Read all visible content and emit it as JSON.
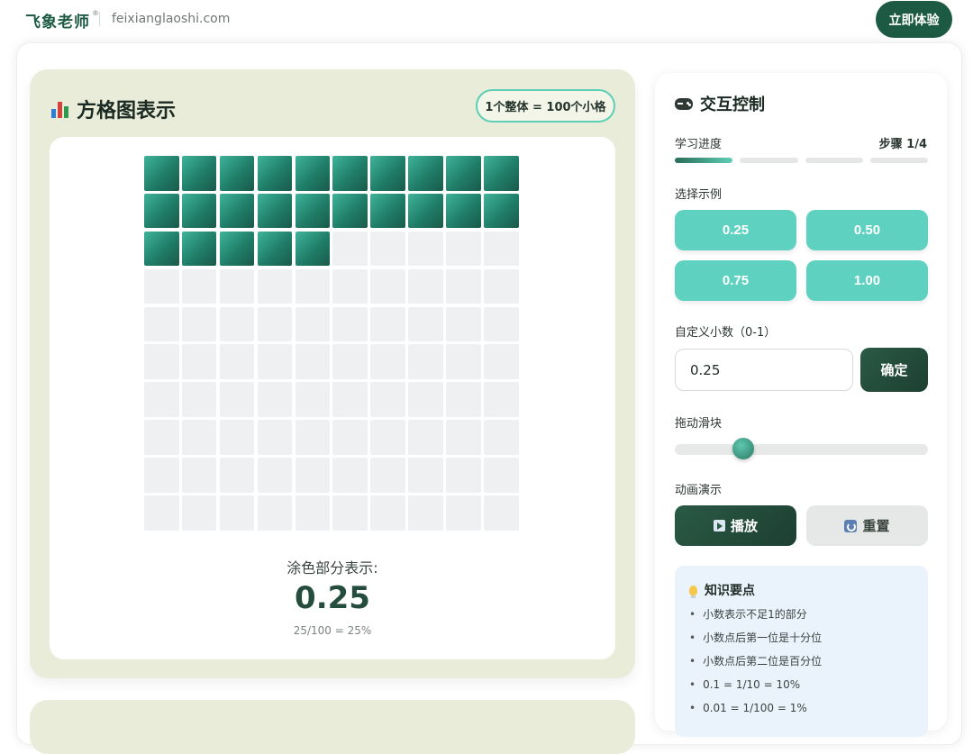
{
  "header": {
    "brand": "飞象老师",
    "brand_mark": "®",
    "domain": "feixianglaoshi.com",
    "cta_label": "立即体验"
  },
  "grid_card": {
    "title": "方格图表示",
    "title_icon": "bar-chart-icon",
    "unit_note": "1个整体 = 100个小格",
    "rows": 10,
    "cols": 10,
    "filled_cells": 25,
    "shade_label": "涂色部分表示:",
    "shade_value": "0.25",
    "shade_detail": "25/100 = 25%",
    "colors": {
      "filled": "#1f7d68",
      "empty": "#eef0f1",
      "card_bg": "#e9ecd9"
    }
  },
  "controls": {
    "title": "交互控制",
    "title_icon": "gamepad-icon",
    "progress_label": "学习进度",
    "step_text": "步骤 1/4",
    "progress": {
      "current": 1,
      "total": 4
    },
    "examples_label": "选择示例",
    "examples": [
      "0.25",
      "0.50",
      "0.75",
      "1.00"
    ],
    "custom_label": "自定义小数（0-1）",
    "custom_value": "0.25",
    "confirm_label": "确定",
    "slider_label": "拖动滑块",
    "slider_value": 0.25,
    "animation_label": "动画演示",
    "play_label": "播放",
    "reset_label": "重置",
    "accent": "#5fd1c0",
    "dark": "#1d3f31"
  },
  "tips": {
    "title": "知识要点",
    "items": [
      "小数表示不足1的部分",
      "小数点后第一位是十分位",
      "小数点后第二位是百分位",
      "0.1 = 1/10 = 10%",
      "0.01 = 1/100 = 1%"
    ]
  }
}
